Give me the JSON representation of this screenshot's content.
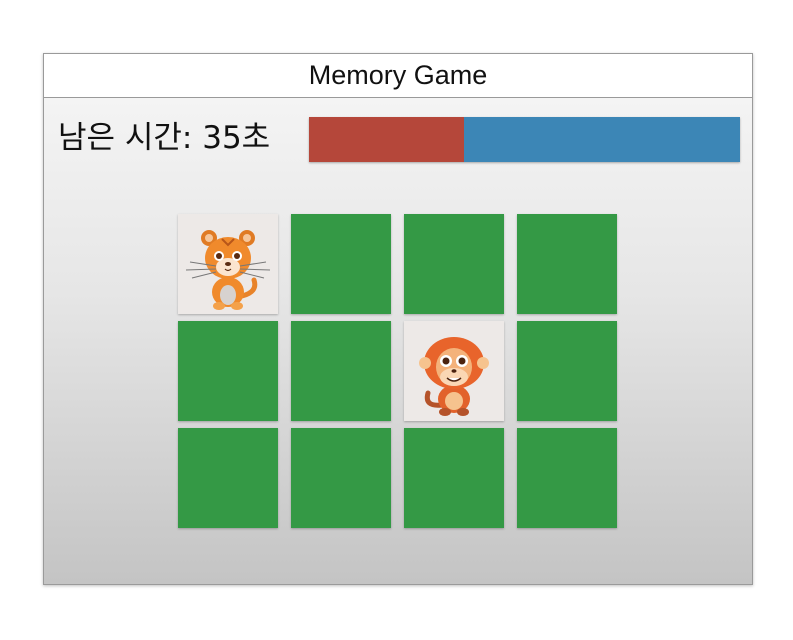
{
  "window": {
    "title": "Memory Game"
  },
  "timer": {
    "label": "남은 시간: 35초",
    "remaining_seconds": 35,
    "elapsed_fraction": 0.36,
    "elapsed_color": "#b5473a",
    "remaining_color": "#3c86b6"
  },
  "board": {
    "rows": 3,
    "cols": 4,
    "card_back_color": "#349945",
    "cards": [
      {
        "state": "revealed",
        "animal": "tiger-cub-icon"
      },
      {
        "state": "hidden"
      },
      {
        "state": "hidden"
      },
      {
        "state": "hidden"
      },
      {
        "state": "hidden"
      },
      {
        "state": "hidden"
      },
      {
        "state": "revealed",
        "animal": "monkey-icon"
      },
      {
        "state": "hidden"
      },
      {
        "state": "hidden"
      },
      {
        "state": "hidden"
      },
      {
        "state": "hidden"
      },
      {
        "state": "hidden"
      }
    ]
  }
}
